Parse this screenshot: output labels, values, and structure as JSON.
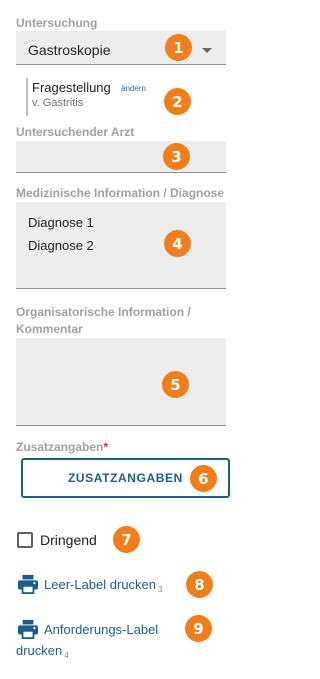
{
  "untersuchung": {
    "label": "Untersuchung",
    "value": "Gastroskopie",
    "badge": "1"
  },
  "fragestellung": {
    "title": "Fragestellung",
    "link": "ändern",
    "sub": "v. Gastritis",
    "badge": "2"
  },
  "arzt": {
    "label": "Untersuchender Arzt",
    "value": "",
    "badge": "3"
  },
  "diagnose": {
    "label": "Medizinische Information / Diagnose",
    "lines": [
      "Diagnose 1",
      "Diagnose 2"
    ],
    "badge": "4"
  },
  "kommentar": {
    "label_line1": "Organisatorische Information /",
    "label_line2": "Kommentar",
    "badge": "5"
  },
  "zusatz": {
    "label": "Zusatzangaben",
    "required_mark": "*",
    "button": "ZUSATZANGABEN",
    "badge": "6"
  },
  "dringend": {
    "label": "Dringend",
    "checked": false,
    "badge": "7"
  },
  "leer_label": {
    "text": "Leer-Label drucken",
    "count": "3",
    "badge": "8"
  },
  "anforderung": {
    "text_line1": "Anforderungs-Label",
    "text_line2": "drucken",
    "count": "4",
    "badge": "9"
  },
  "colors": {
    "badge": "#f07e1a",
    "accent": "#1b5e8c",
    "field_bg": "#ededed",
    "required": "#d32f2f"
  }
}
